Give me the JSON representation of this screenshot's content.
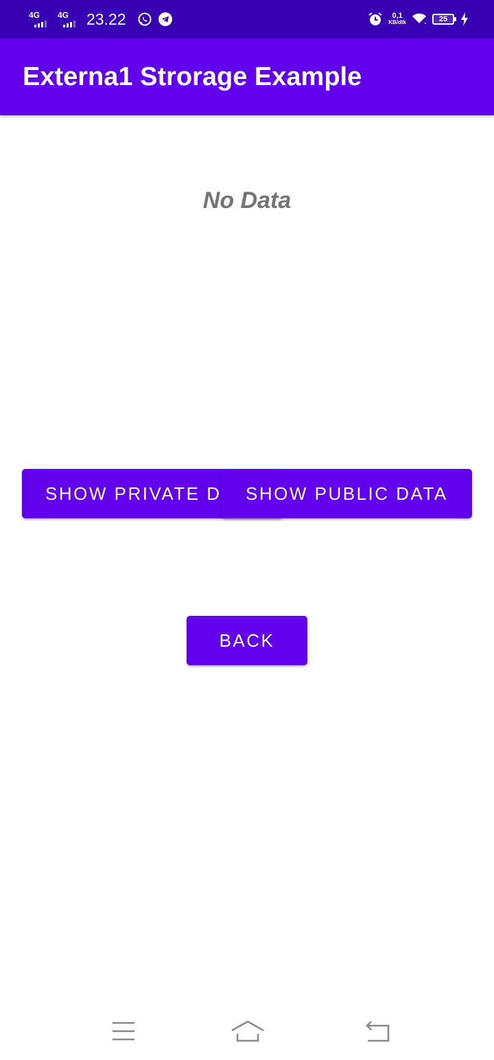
{
  "status_bar": {
    "signal_1": "4G",
    "signal_2": "4G",
    "time": "23.22",
    "left_icons": [
      "whatsapp-icon",
      "telegram-icon"
    ],
    "right_icons": [
      "alarm-icon",
      "wifi-icon",
      "battery-icon",
      "charging-icon"
    ],
    "net_speed_value": "0,1",
    "net_speed_unit": "KB/dtk",
    "battery_level": "25"
  },
  "app_bar": {
    "title": "Externa1 Strorage Example"
  },
  "content": {
    "message": "No Data",
    "buttons": {
      "private": "SHOW PRIVATE D",
      "public": "SHOW PUBLIC DATA",
      "back": "BACK"
    }
  },
  "nav_bar": {
    "icons": [
      "menu-icon",
      "home-icon",
      "back-icon"
    ]
  },
  "colors": {
    "status_bar": "#3700B3",
    "primary": "#6200EE",
    "message_text": "#757575",
    "nav_icon": "#888888"
  }
}
